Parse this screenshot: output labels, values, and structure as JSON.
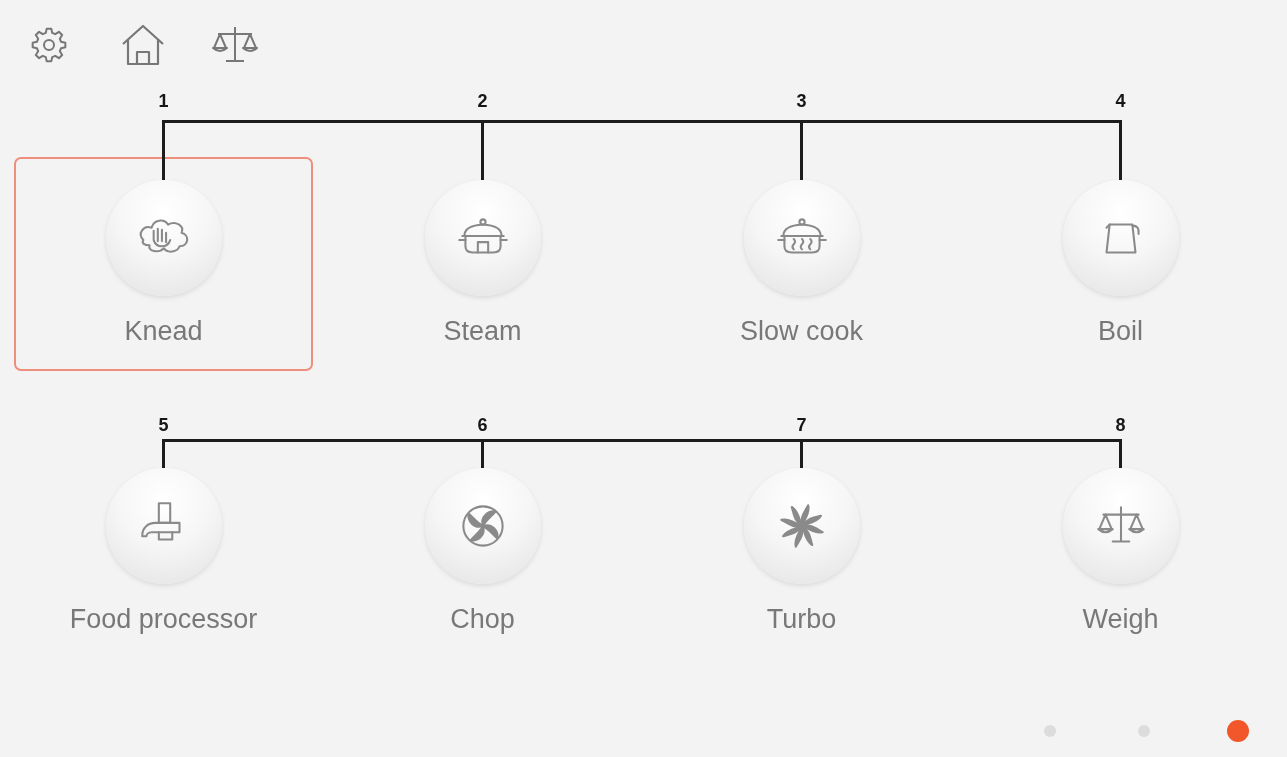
{
  "mode_rows": [
    {
      "modes": [
        {
          "callout": "1",
          "label": "Knead",
          "selected": true
        },
        {
          "callout": "2",
          "label": "Steam",
          "selected": false
        },
        {
          "callout": "3",
          "label": "Slow cook",
          "selected": false
        },
        {
          "callout": "4",
          "label": "Boil",
          "selected": false
        }
      ]
    },
    {
      "modes": [
        {
          "callout": "5",
          "label": "Food processor",
          "selected": false
        },
        {
          "callout": "6",
          "label": "Chop",
          "selected": false
        },
        {
          "callout": "7",
          "label": "Turbo",
          "selected": false
        },
        {
          "callout": "8",
          "label": "Weigh",
          "selected": false
        }
      ]
    }
  ],
  "pages": [
    {
      "selected": false
    },
    {
      "selected": false
    },
    {
      "selected": true
    }
  ]
}
